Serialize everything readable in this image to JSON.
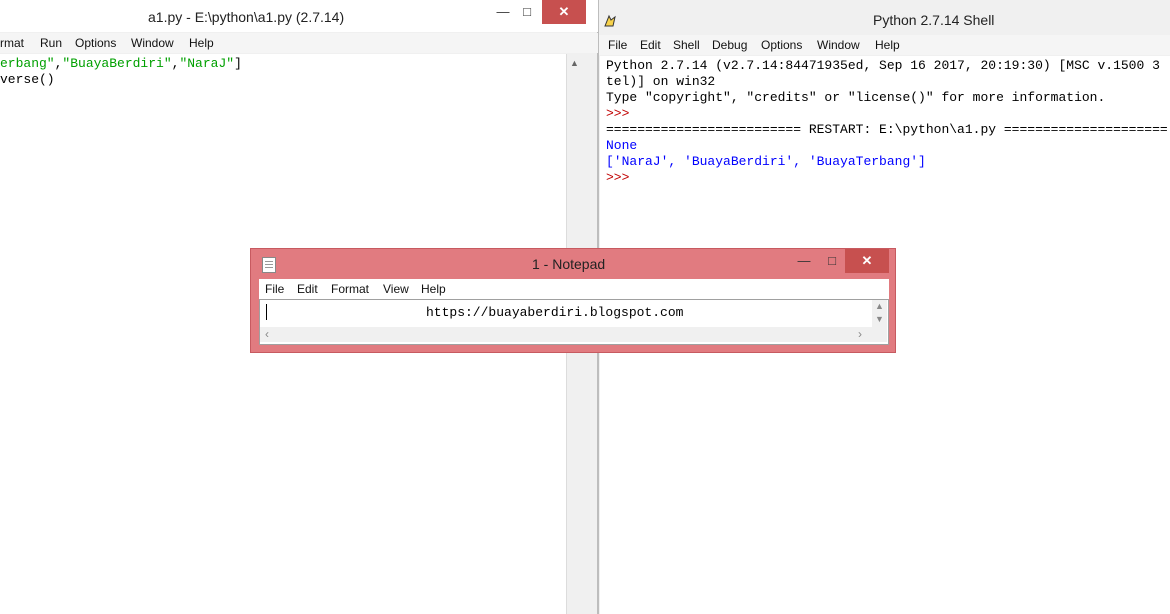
{
  "editor": {
    "title": "a1.py - E:\\python\\a1.py (2.7.14)",
    "controls": {
      "minimize": "—",
      "maximize": "□",
      "close": "✕"
    },
    "menu": [
      "rmat",
      "Run",
      "Options",
      "Window",
      "Help"
    ],
    "code": {
      "line1_s1": "erbang\"",
      "line1_c1": ",",
      "line1_s2": "\"BuayaBerdiri\"",
      "line1_c2": ",",
      "line1_s3": "\"NaraJ\"",
      "line1_end": "]",
      "line2": "verse()"
    },
    "scroll_up": "▲"
  },
  "shell": {
    "title": "Python 2.7.14 Shell",
    "menu": [
      "File",
      "Edit",
      "Shell",
      "Debug",
      "Options",
      "Window",
      "Help"
    ],
    "lines": {
      "l1": "Python 2.7.14 (v2.7.14:84471935ed, Sep 16 2017, 20:19:30) [MSC v.1500 3",
      "l2": "tel)] on win32",
      "l3": "Type \"copyright\", \"credits\" or \"license()\" for more information.",
      "l4": ">>> ",
      "l5": "========================= RESTART: E:\\python\\a1.py =====================",
      "l6": "None",
      "l7": "['NaraJ', 'BuayaBerdiri', 'BuayaTerbang']",
      "l8": ">>> "
    }
  },
  "notepad": {
    "title": "1 - Notepad",
    "controls": {
      "minimize": "—",
      "maximize": "□",
      "close": "✕"
    },
    "menu": [
      "File",
      "Edit",
      "Format",
      "View",
      "Help"
    ],
    "content": "https://buayaberdiri.blogspot.com",
    "arrows": {
      "up": "▲",
      "down": "▼",
      "left": "‹",
      "right": "›"
    }
  }
}
